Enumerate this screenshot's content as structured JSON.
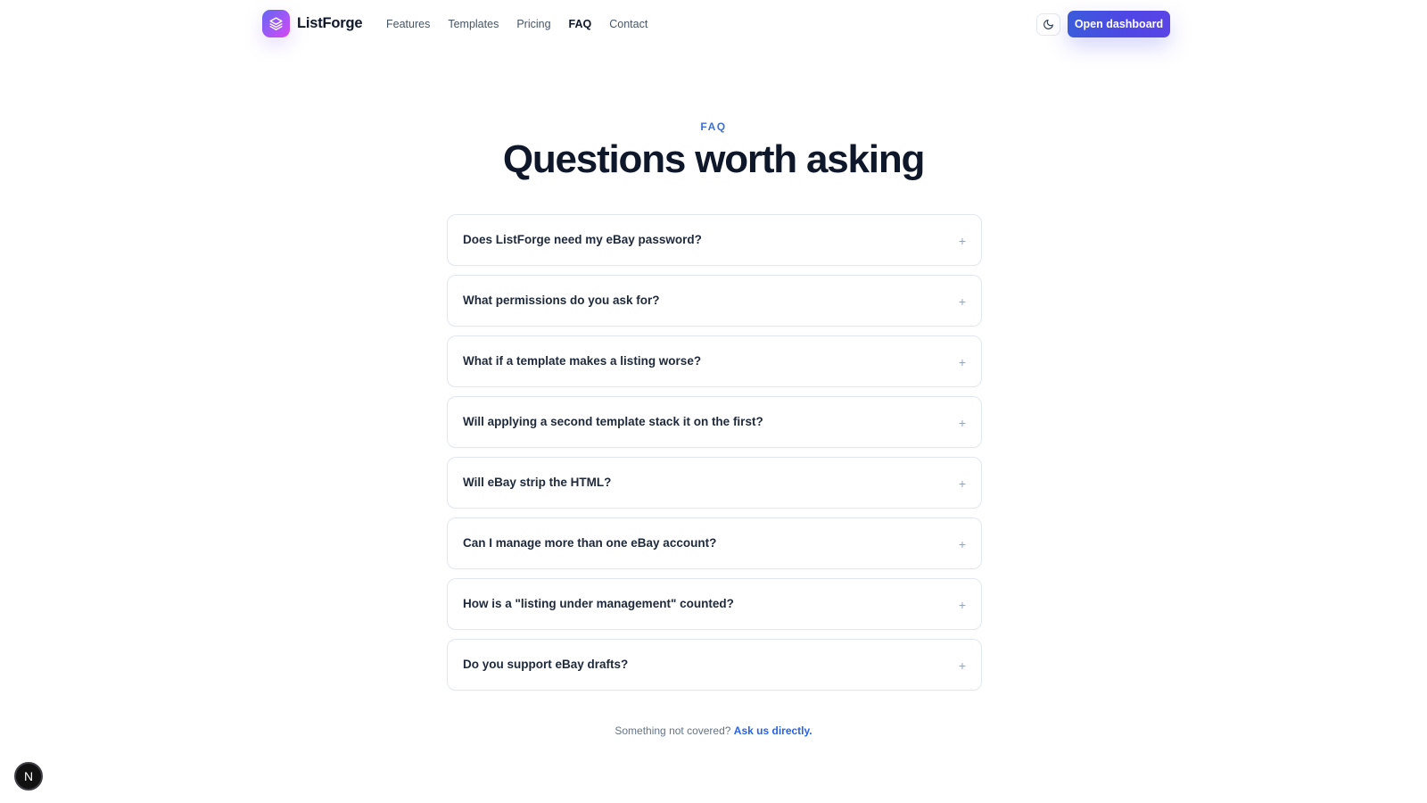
{
  "brand": {
    "name": "ListForge",
    "logo_icon": "layers-icon"
  },
  "nav": {
    "items": [
      {
        "label": "Features",
        "active": false
      },
      {
        "label": "Templates",
        "active": false
      },
      {
        "label": "Pricing",
        "active": false
      },
      {
        "label": "FAQ",
        "active": true
      },
      {
        "label": "Contact",
        "active": false
      }
    ]
  },
  "header": {
    "theme_icon": "moon-icon",
    "cta_label": "Open dashboard"
  },
  "hero": {
    "eyebrow": "FAQ",
    "title": "Questions worth asking"
  },
  "faq": {
    "items": [
      {
        "question": "Does ListForge need my eBay password?",
        "toggle": "+"
      },
      {
        "question": "What permissions do you ask for?",
        "toggle": "+"
      },
      {
        "question": "What if a template makes a listing worse?",
        "toggle": "+"
      },
      {
        "question": "Will applying a second template stack it on the first?",
        "toggle": "+"
      },
      {
        "question": "Will eBay strip the HTML?",
        "toggle": "+"
      },
      {
        "question": "Can I manage more than one eBay account?",
        "toggle": "+"
      },
      {
        "question": "How is a \"listing under management\" counted?",
        "toggle": "+"
      },
      {
        "question": "Do you support eBay drafts?",
        "toggle": "+"
      }
    ]
  },
  "footer": {
    "note": "Something not covered?",
    "link": "Ask us directly."
  },
  "dev_badge": {
    "letter": "N"
  },
  "colors": {
    "accent": "#4f46e5",
    "link": "#2563eb",
    "eyebrow": "#3b6fd9",
    "text": "#0f172a"
  }
}
